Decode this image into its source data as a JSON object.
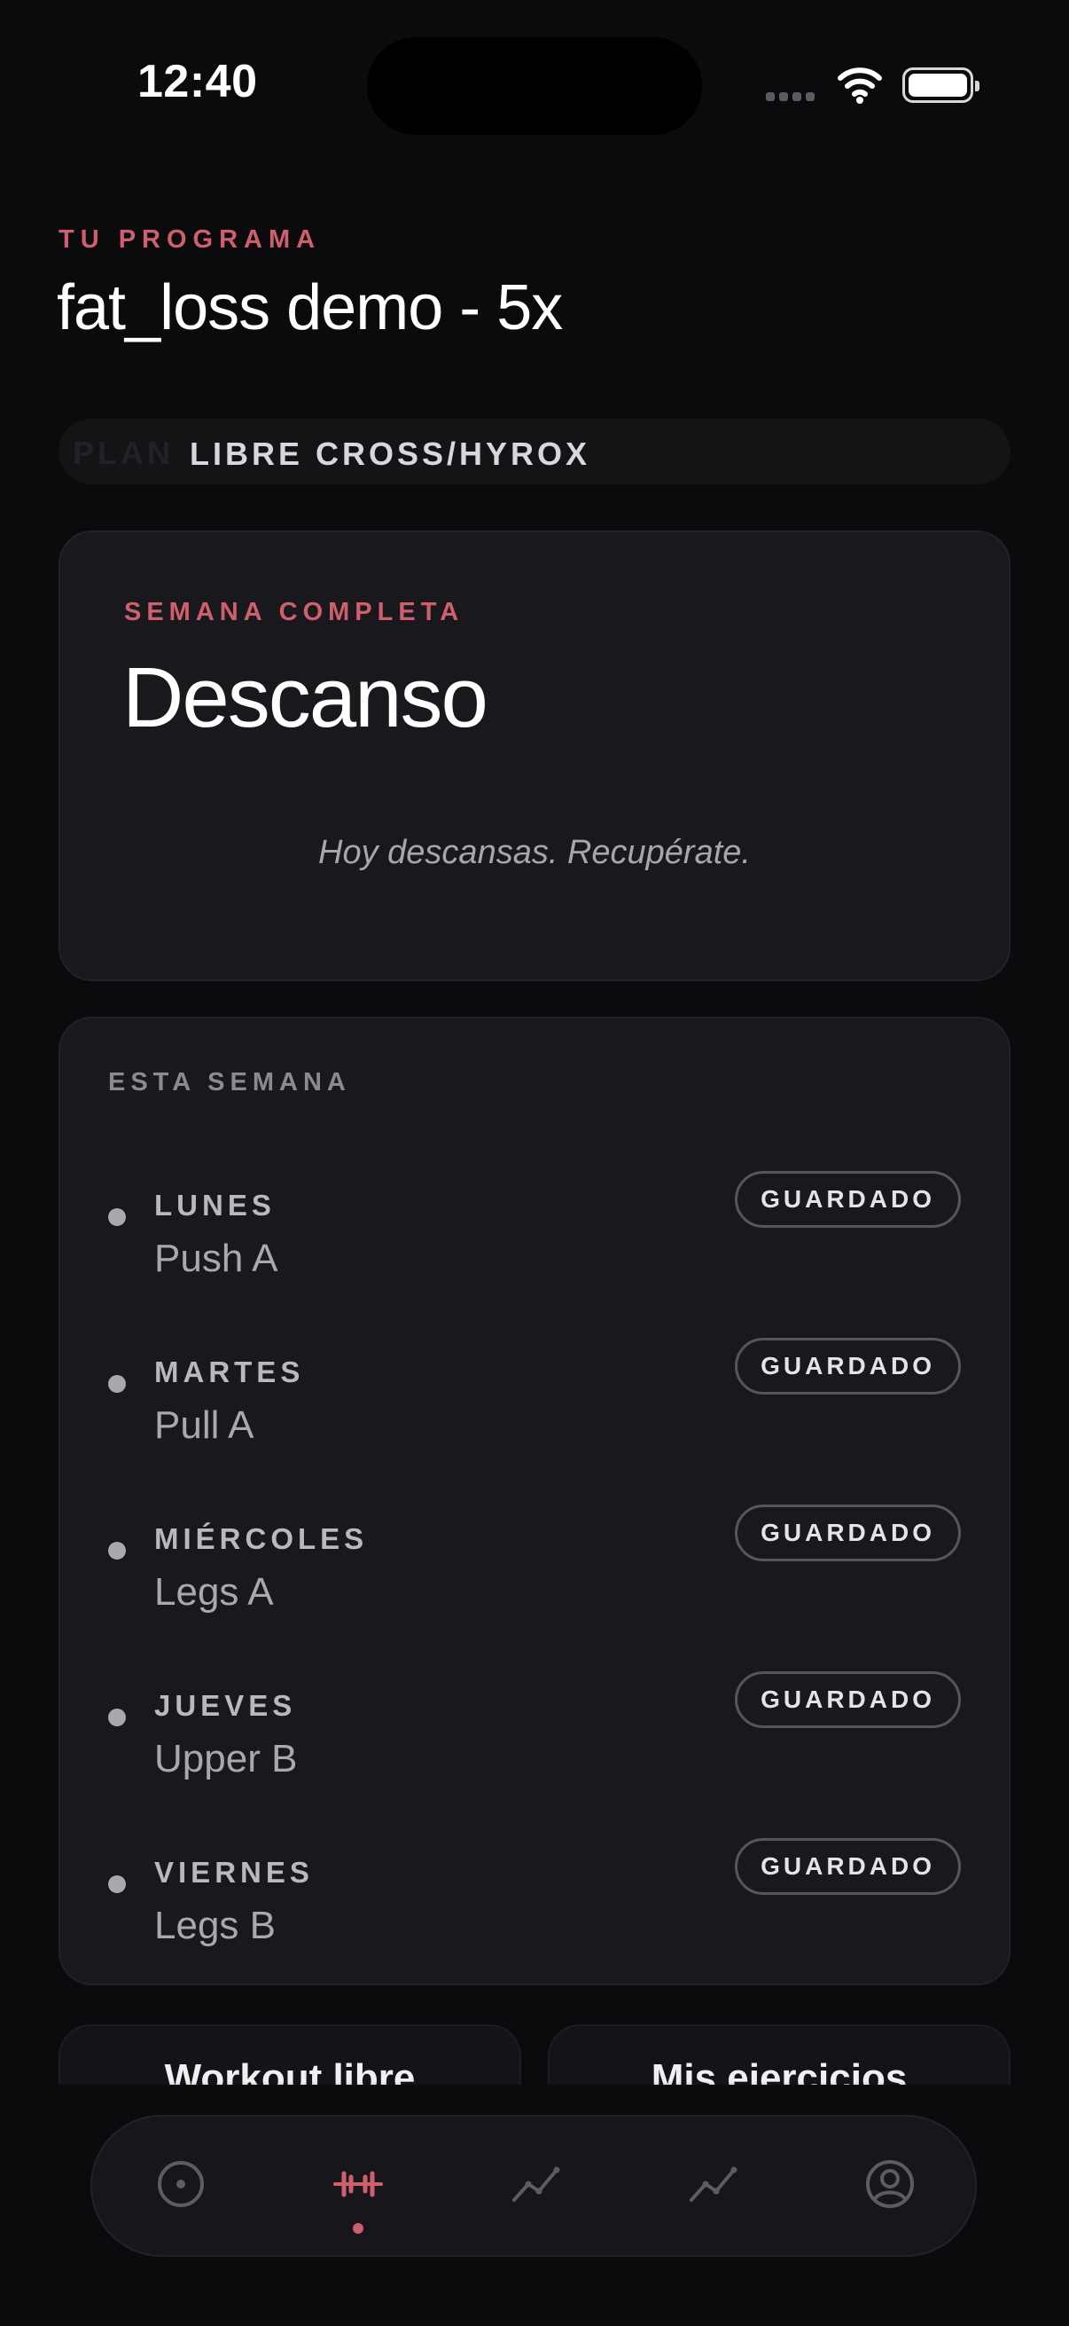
{
  "status_bar": {
    "time": "12:40"
  },
  "header": {
    "eyebrow": "TU PROGRAMA",
    "title": "fat_loss demo - 5x"
  },
  "plan": {
    "ghost_label": "PLAN",
    "label": "LIBRE CROSS/HYROX"
  },
  "today_card": {
    "label": "SEMANA COMPLETA",
    "title": "Descanso",
    "message": "Hoy descansas. Recupérate."
  },
  "week": {
    "label": "ESTA SEMANA",
    "days": [
      {
        "day": "LUNES",
        "workout": "Push A",
        "status": "GUARDADO"
      },
      {
        "day": "MARTES",
        "workout": "Pull A",
        "status": "GUARDADO"
      },
      {
        "day": "MIÉRCOLES",
        "workout": "Legs A",
        "status": "GUARDADO"
      },
      {
        "day": "JUEVES",
        "workout": "Upper B",
        "status": "GUARDADO"
      },
      {
        "day": "VIERNES",
        "workout": "Legs B",
        "status": "GUARDADO"
      }
    ]
  },
  "quick_actions": {
    "free_workout": "Workout libre",
    "my_exercises": "Mis ejercicios"
  },
  "tabbar": {
    "items": [
      {
        "icon": "target-icon",
        "active": false
      },
      {
        "icon": "dumbbell-icon",
        "active": true
      },
      {
        "icon": "trend-icon",
        "active": false
      },
      {
        "icon": "trend-icon",
        "active": false
      },
      {
        "icon": "profile-icon",
        "active": false
      }
    ]
  },
  "colors": {
    "accent": "#cf5f6c",
    "background": "#0b0b0d",
    "card": "#18181d"
  }
}
